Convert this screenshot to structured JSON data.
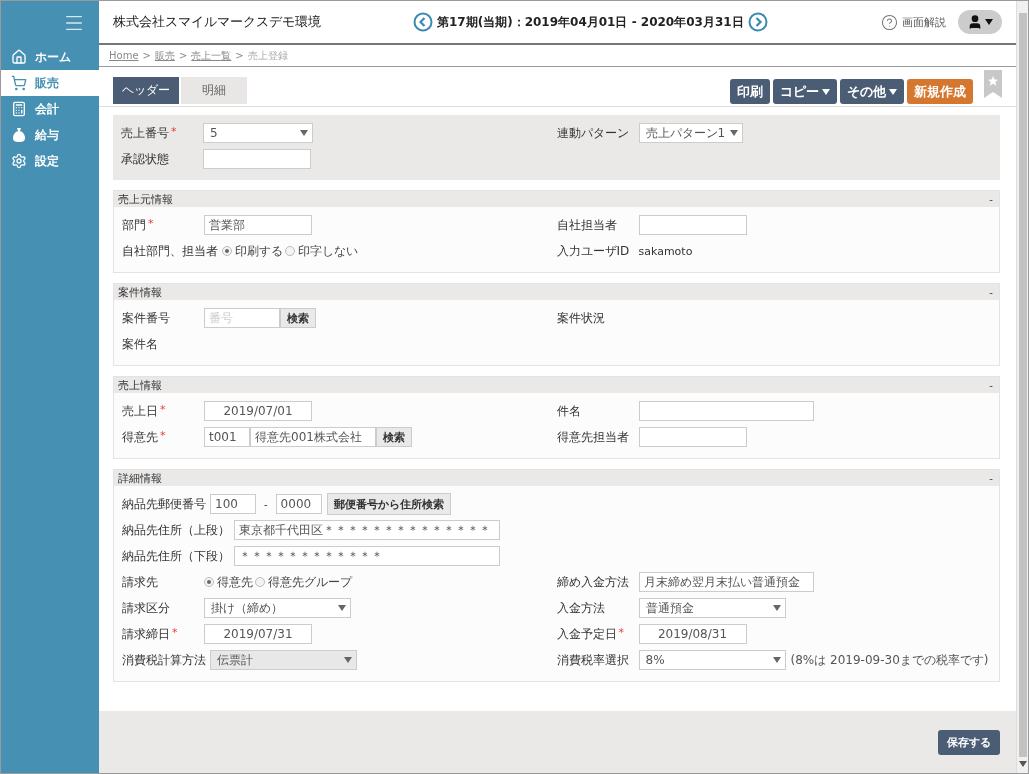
{
  "sidebar": {
    "items": [
      {
        "label": "ホーム",
        "selected": false
      },
      {
        "label": "販売",
        "selected": true
      },
      {
        "label": "会計",
        "selected": false
      },
      {
        "label": "給与",
        "selected": false
      },
      {
        "label": "設定",
        "selected": false
      }
    ]
  },
  "header": {
    "company": "株式会社スマイルマークスデモ環境",
    "period": "第17期(当期)：2019年04月01日 - 2020年03月31日",
    "help": "画面解説"
  },
  "breadcrumb": [
    {
      "label": "Home",
      "kind": "link"
    },
    {
      "label": ">",
      "kind": "separator"
    },
    {
      "label": "販売",
      "kind": "link"
    },
    {
      "label": ">",
      "kind": "separator"
    },
    {
      "label": "売上一覧",
      "kind": "link"
    },
    {
      "label": ">",
      "kind": "separator"
    },
    {
      "label": "売上登録",
      "kind": "current"
    }
  ],
  "tabs": [
    {
      "label": "ヘッダー",
      "selected": true
    },
    {
      "label": "明細",
      "selected": false
    }
  ],
  "actions": [
    {
      "label": "印刷",
      "kind": "plain"
    },
    {
      "label": "コピー",
      "kind": "dropdown"
    },
    {
      "label": "その他",
      "kind": "dropdown"
    },
    {
      "label": "新規作成",
      "kind": "primary"
    }
  ],
  "top_box": {
    "rows": [
      {
        "left": {
          "label": "売上番号",
          "required": "*",
          "kind": "select",
          "value": "5",
          "disabled": false
        },
        "right": {
          "label": "連動パターン",
          "kind": "smallselect",
          "value": "売上パターン1",
          "disabled": false
        }
      },
      {
        "left": {
          "label": "承認状態",
          "kind": "input"
        },
        "right": null
      }
    ]
  },
  "sections": [
    {
      "title": "売上元情報",
      "toggle": "-",
      "rows": [
        {
          "left": {
            "label": "部門",
            "required": "*",
            "kind": "input",
            "value": "営業部"
          },
          "right": {
            "label": "自社担当者",
            "kind": "input"
          }
        },
        {
          "left": {
            "label": "自社部門、担当者",
            "kind": "radio",
            "options": [
              {
                "label": "印刷する",
                "selected": true
              },
              {
                "label": "印字しない",
                "selected": false
              }
            ]
          },
          "right": {
            "label": "入力ユーザID",
            "kind": "static",
            "value": "sakamoto"
          }
        }
      ]
    },
    {
      "title": "案件情報",
      "toggle": "-",
      "rows": [
        {
          "left": {
            "label": "案件番号",
            "kind": "lookup",
            "inputs": [
              {
                "placeholder": "番号"
              }
            ],
            "button": "検索"
          },
          "right": {
            "label": "案件状況",
            "kind": "static"
          }
        },
        {
          "left": {
            "label": "案件名",
            "kind": "static"
          },
          "right": null
        }
      ]
    },
    {
      "title": "売上情報",
      "toggle": "-",
      "rows": [
        {
          "left": {
            "label": "売上日",
            "required": "*",
            "kind": "date",
            "value": "2019/07/01"
          },
          "right": {
            "label": "件名",
            "kind": "longinput"
          }
        },
        {
          "left": {
            "label": "得意先",
            "required": "*",
            "kind": "lookup",
            "inputs": [
              {
                "value": "t001"
              },
              {
                "value": "得意先001株式会社"
              }
            ],
            "button": "検索"
          },
          "right": {
            "label": "得意先担当者",
            "kind": "input"
          }
        }
      ]
    },
    {
      "title": "詳細情報",
      "toggle": "-",
      "rows": [
        {
          "left": {
            "label": "納品先郵便番号",
            "kind": "postal",
            "inputs": [
              {
                "value": "100"
              },
              {
                "value": "0000"
              }
            ],
            "separator": "-",
            "button": "郵便番号から住所検索"
          },
          "right": null
        },
        {
          "left": {
            "label": "納品先住所（上段）",
            "kind": "addressinput",
            "value": "東京都千代田区＊＊＊＊＊＊＊＊＊＊＊＊＊＊"
          },
          "right": null
        },
        {
          "left": {
            "label": "納品先住所（下段）",
            "kind": "addressinput",
            "value": "＊＊＊＊＊＊＊＊＊＊＊＊"
          },
          "right": null
        },
        {
          "left": {
            "label": "請求先",
            "kind": "radio",
            "options": [
              {
                "label": "得意先",
                "selected": true
              },
              {
                "label": "得意先グループ",
                "selected": false
              }
            ]
          },
          "right": {
            "label": "締め入金方法",
            "kind": "longinput",
            "value": "月末締め翌月末払い普通預金"
          }
        },
        {
          "left": {
            "label": "請求区分",
            "kind": "longselect",
            "value": "掛け（締め）",
            "disabled": false
          },
          "right": {
            "label": "入金方法",
            "kind": "longselect",
            "value": "普通預金",
            "disabled": false
          }
        },
        {
          "left": {
            "label": "請求締日",
            "required": "*",
            "kind": "date",
            "value": "2019/07/31"
          },
          "right": {
            "label": "入金予定日",
            "required": "*",
            "kind": "date",
            "value": "2019/08/31"
          }
        },
        {
          "left": {
            "label": "消費税計算方法",
            "kind": "longselect",
            "value": "伝票計",
            "disabled": true
          },
          "right": {
            "label": "消費税率選択",
            "kind": "longselect",
            "value": "8%",
            "disabled": false,
            "note": "(8%は 2019-09-30までの税率です)"
          }
        }
      ]
    }
  ],
  "save_button": "保存する"
}
